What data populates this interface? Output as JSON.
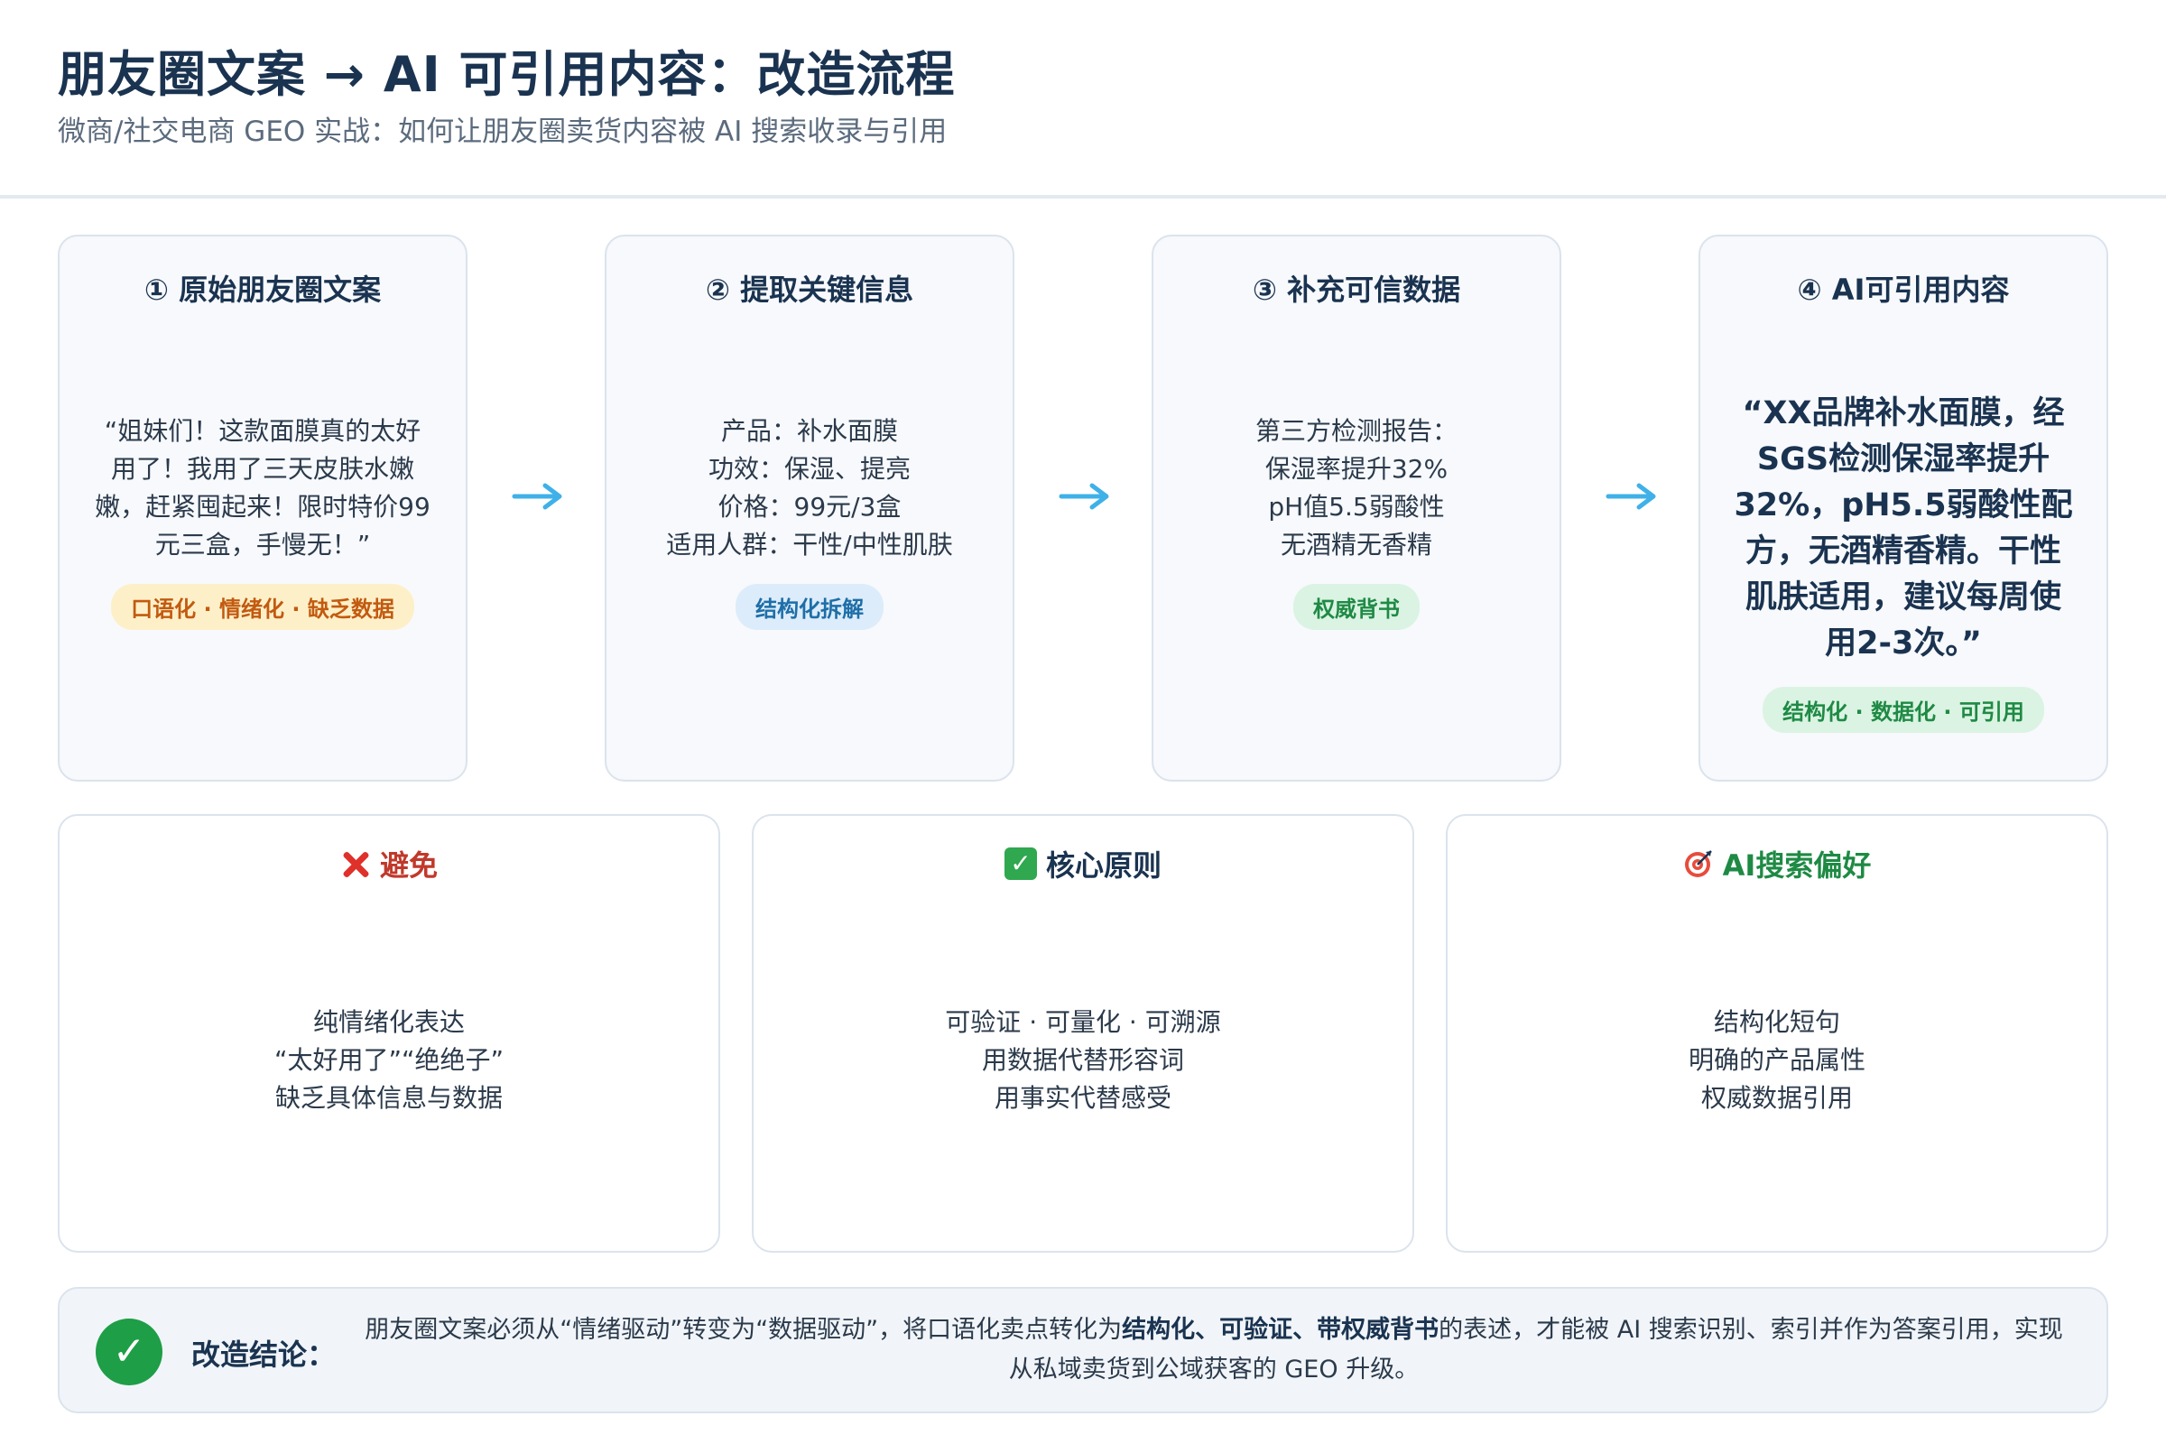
{
  "header": {
    "title": "朋友圈文案 → AI 可引用内容：改造流程",
    "subtitle": "微商/社交电商 GEO 实战：如何让朋友圈卖货内容被 AI 搜索收录与引用"
  },
  "steps": [
    {
      "title": "① 原始朋友圈文案",
      "text": "“姐妹们！这款面膜真的太好\n用了！我用了三天皮肤水嫩\n嫩，赶紧囤起来！限时特价99\n元三盒，手慢无！”",
      "tag": "口语化 · 情绪化 · 缺乏数据"
    },
    {
      "title": "② 提取关键信息",
      "text": "产品：补水面膜\n功效：保湿、提亮\n价格：99元/3盒\n适用人群：干性/中性肌肤",
      "tag": "结构化拆解"
    },
    {
      "title": "③ 补充可信数据",
      "text": "第三方检测报告：\n保湿率提升32%\npH值5.5弱酸性\n无酒精无香精",
      "tag": "权威背书"
    },
    {
      "title": "④ AI可引用内容",
      "text": "“XX品牌补水面膜，经\nSGS检测保湿率提升\n32%，pH5.5弱酸性配\n方，无酒精香精。干性\n肌肤适用，建议每周使\n用2-3次。”",
      "tag": "结构化 · 数据化 · 可引用"
    }
  ],
  "principles": [
    {
      "icon": "cross-mark-icon",
      "title": "避免",
      "lines": [
        "纯情绪化表达",
        "“太好用了”“绝绝子”",
        "缺乏具体信息与数据"
      ]
    },
    {
      "icon": "check-mark-icon",
      "title": "核心原则",
      "lines": [
        "可验证 · 可量化 · 可溯源",
        "用数据代替形容词",
        "用事实代替感受"
      ]
    },
    {
      "icon": "target-icon",
      "title": "AI搜索偏好",
      "lines": [
        "结构化短句",
        "明确的产品属性",
        "权威数据引用"
      ]
    }
  ],
  "conclusion": {
    "label": "改造结论：",
    "text_before": "朋友圈文案必须从“情绪驱动”转变为“数据驱动”，将口语化卖点转化为",
    "text_bold": "结构化、可验证、带权威背书",
    "text_after": "的表述，才能被 AI 搜索识别、索引并作为答案引用，实现从私域卖货到公域获客的 GEO 升级。"
  },
  "colors": {
    "title": "#1a3350",
    "arrow": "#3fb1e8",
    "tag_orange": "#c25a10",
    "tag_blue": "#1e6ea8",
    "tag_green": "#1e8a44",
    "avoid_red": "#c0392b"
  }
}
